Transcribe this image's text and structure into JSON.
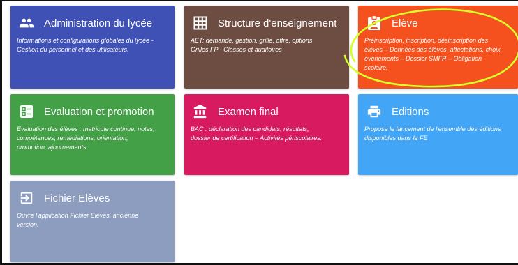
{
  "tiles": [
    {
      "id": "administration",
      "title": "Administration du lycée",
      "desc_lines": [
        "Informations et configurations globales du lycée -",
        "Gestion du personnel et des utilisateurs."
      ],
      "icon": "people-icon",
      "color": "#3f51b5"
    },
    {
      "id": "structure",
      "title": "Structure d'enseignement",
      "desc_lines": [
        "AET: demande, gestion, grille, offre, options",
        "Grilles FP - Classes et auditoires"
      ],
      "icon": "grid-icon",
      "color": "#6d4c41"
    },
    {
      "id": "eleve",
      "title": "Elève",
      "desc_lines": [
        "Préinscription, inscription, désinscription des",
        "élèves – Données des élèves, affectations, choix,",
        "évènements – Dossier SMFR – Obligation",
        "scolaire."
      ],
      "icon": "badge-icon",
      "color": "#f4511e"
    },
    {
      "id": "evaluation",
      "title": "Evaluation et promotion",
      "desc_lines": [
        "Evaluation des élèves : matricule continue, notes,",
        "compétences, remédiations, orientation,",
        "promotion, ajournements."
      ],
      "icon": "checklist-icon",
      "color": "#43a047"
    },
    {
      "id": "examen",
      "title": "Examen final",
      "desc_lines": [
        "BAC : déclaration des candidats, résultats,",
        "dossier de certification – Activités périscolaires."
      ],
      "icon": "bank-icon",
      "color": "#d81b60"
    },
    {
      "id": "editions",
      "title": "Editions",
      "desc_lines": [
        "Propose le lancement de l'ensemble des éditions",
        "disponibles dans le FE"
      ],
      "icon": "printer-icon",
      "color": "#42a5f5"
    },
    {
      "id": "fichier",
      "title": "Fichier Elèves",
      "desc_lines": [
        "Ouvre l'application Fichier Elèves, ancienne",
        "version."
      ],
      "icon": "exit-to-app-icon",
      "color": "#8c9dbf"
    }
  ],
  "annotation": {
    "highlight_color": "#d4ff2a"
  }
}
